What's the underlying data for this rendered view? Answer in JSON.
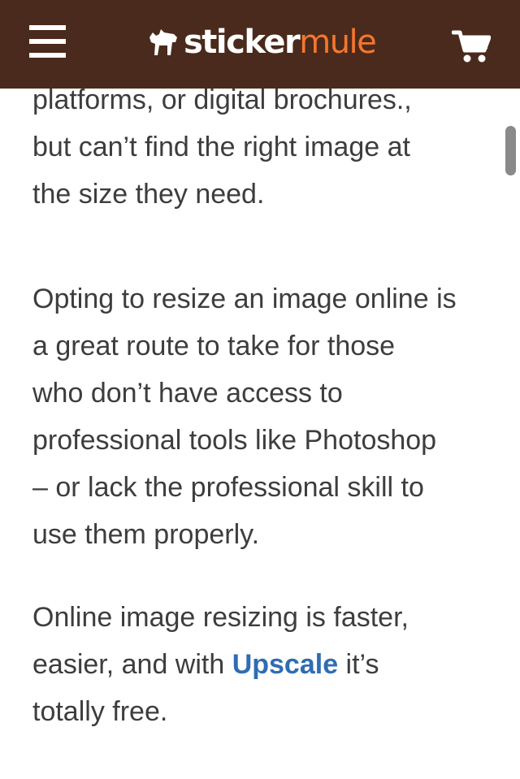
{
  "header": {
    "logo": {
      "word1": "sticker",
      "word2": "mule"
    },
    "icons": {
      "menu": "hamburger-menu-icon",
      "cart": "shopping-cart-icon",
      "logo": "mule-icon"
    },
    "colors": {
      "bar": "#4a2a1c",
      "brand_orange": "#f4772e"
    }
  },
  "article": {
    "p1_lines": [
      "platforms, or digital brochures.,",
      "but can’t find the right image at",
      "the size they need."
    ],
    "p2_lines": [
      "Opting to resize an image online is",
      "a great route to take for those",
      "who don’t have access to",
      "professional tools like Photoshop",
      "– or lack the professional skill to",
      "use them properly."
    ],
    "p3": {
      "line1": "Online image resizing is faster,",
      "line2_before": "easier, and with ",
      "link": "Upscale",
      "line2_after": " it’s",
      "line3": "totally free."
    },
    "colors": {
      "text": "#3d3d3d",
      "link": "#2f6db3"
    }
  }
}
